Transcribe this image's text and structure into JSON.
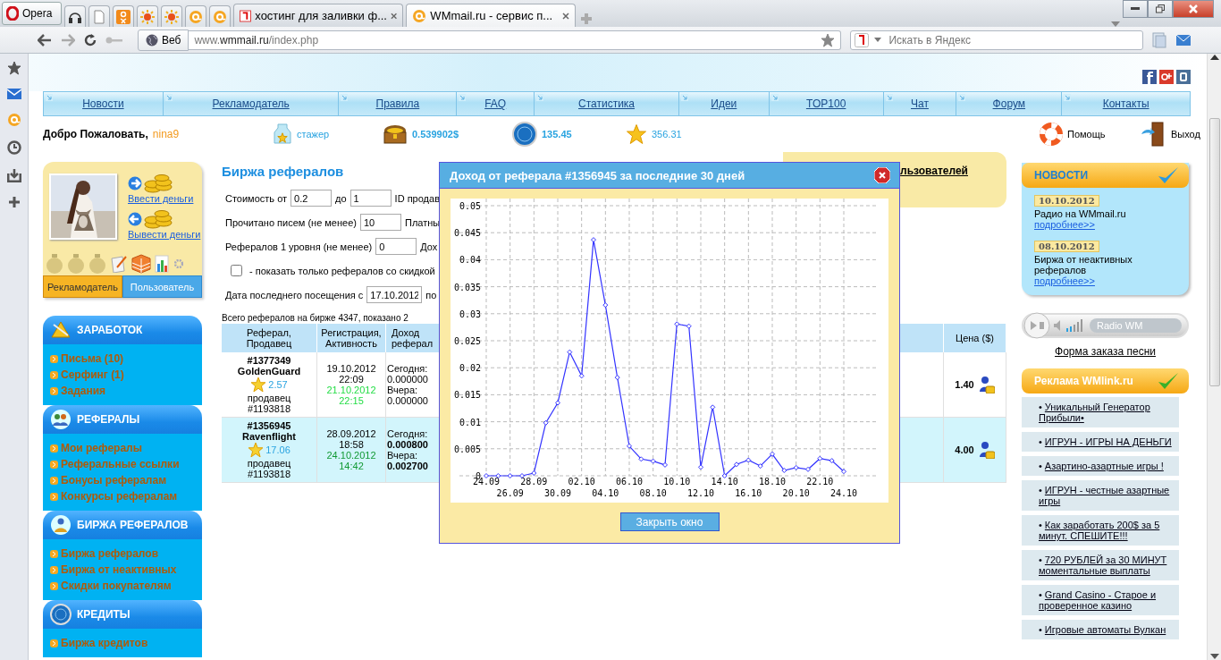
{
  "browser": {
    "menu_button": "Opera",
    "tabs": [
      {
        "title": "хостинг для заливки ф...",
        "selected": false
      },
      {
        "title": "WMmail.ru - сервис п...",
        "selected": true
      }
    ],
    "address": {
      "mode": "Веб",
      "url": "www.**wmmail.ru**/index.php"
    },
    "search": {
      "placeholder": "Искать в Яндекс"
    }
  },
  "nav": [
    "Новости",
    "Рекламодатель",
    "Правила",
    "FAQ",
    "Статистика",
    "Идеи",
    "TOP100",
    "Чат",
    "Форум",
    "Контакты"
  ],
  "welcome": {
    "greeting": "Добро Пожаловать,",
    "user": "nina9",
    "status": "стажер",
    "balance": "0.539902$",
    "credits": "135.45",
    "rating": "356.31",
    "help": "Помощь",
    "logout": "Выход"
  },
  "user_card": {
    "deposit": "Ввести деньги",
    "withdraw": "Вывести деньги",
    "tabs": [
      {
        "label": "Рекламодатель",
        "selected": true
      },
      {
        "label": "Пользователь",
        "selected": false
      }
    ]
  },
  "menu": [
    {
      "title": "ЗАРАБОТОК",
      "items": [
        "Письма (10)",
        "Серфинг (1)",
        "Задания"
      ]
    },
    {
      "title": "РЕФЕРАЛЫ",
      "items": [
        "Мои рефералы",
        "Реферальные ссылки",
        "Бонусы рефералам",
        "Конкурсы рефералам"
      ]
    },
    {
      "title": "БИРЖА РЕФЕРАЛОВ",
      "items": [
        "Биржа рефералов",
        "Биржа от неактивных",
        "Скидки покупателям"
      ]
    },
    {
      "title": "КРЕДИТЫ",
      "items": [
        "Биржа кредитов"
      ]
    }
  ],
  "main": {
    "title": "Биржа рефералов",
    "side_box": "льзователей",
    "filters": [
      [
        {
          "kind": "label",
          "text": "Стоимость от"
        },
        {
          "kind": "field",
          "value": "0.2"
        },
        {
          "kind": "label",
          "text": "до"
        },
        {
          "kind": "field",
          "value": "1"
        },
        {
          "kind": "label",
          "text": "ID продав"
        }
      ],
      [
        {
          "kind": "label",
          "text": "Прочитано писем (не менее)"
        },
        {
          "kind": "field",
          "value": "10"
        },
        {
          "kind": "label",
          "text": "Платны"
        }
      ],
      [
        {
          "kind": "label",
          "text": "Рефералов 1 уровня (не менее)"
        },
        {
          "kind": "field",
          "value": "0"
        },
        {
          "kind": "label",
          "text": "Дох"
        }
      ],
      [
        {
          "kind": "checkbox",
          "checked": false
        },
        {
          "kind": "label",
          "text": "- показать только рефералов со скидкой"
        }
      ],
      [
        {
          "kind": "label",
          "text": "Дата последнего посещения с"
        },
        {
          "kind": "field",
          "value": "17.10.2012"
        },
        {
          "kind": "label",
          "text": "по"
        }
      ]
    ],
    "summary": "Всего рефералов на бирже 4347, показано 2",
    "table": {
      "columns": [
        "Реферал,\nПродавец",
        "Регистрация,\nАктивность",
        "Доход\nреферал",
        "Цена ($)"
      ],
      "rows": [
        {
          "selected": false,
          "ref": "#1377349",
          "name": "GoldenGuard",
          "rating": "2.57",
          "seller_label": "продавец",
          "seller": "#1193818",
          "registered": [
            "19.10.2012",
            "22:09"
          ],
          "active": {
            "date": "21.10.2012",
            "time": "22:15",
            "color": "#22dd44"
          },
          "income": [
            "Сегодня:",
            "0.000000",
            "Вчера:",
            "0.000000"
          ],
          "income_bold": false,
          "price": "1.40"
        },
        {
          "selected": true,
          "ref": "#1356945",
          "name": "Ravenflight",
          "rating": "17.06",
          "seller_label": "продавец",
          "seller": "#1193818",
          "registered": [
            "28.09.2012",
            "18:58"
          ],
          "active": {
            "date": "24.10.2012",
            "time": "14:42",
            "color": "#119933"
          },
          "income": [
            "Сегодня:",
            "0.000800",
            "Вчера:",
            "0.002700"
          ],
          "income_bold": true,
          "price": "4.00"
        }
      ]
    }
  },
  "modal": {
    "title": "Доход от реферала #1356945 за последние 30 дней",
    "close_button": "Закрыть окно",
    "chart_data": {
      "type": "line",
      "categories": [
        "24.09",
        null,
        "26.09",
        null,
        "28.09",
        null,
        "30.09",
        null,
        "02.10",
        null,
        "04.10",
        null,
        "06.10",
        null,
        "08.10",
        null,
        "10.10",
        null,
        "12.10",
        null,
        "14.10",
        null,
        "16.10",
        null,
        "18.10",
        null,
        "20.10",
        null,
        "22.10",
        null,
        "24.10"
      ],
      "grid": true,
      "series": [
        {
          "color": "#3333ff",
          "marker": "diamond",
          "values": [
            0,
            0,
            0,
            0,
            0.0005,
            0.0098,
            0.0135,
            0.0229,
            0.0185,
            0.0437,
            0.0316,
            0.0182,
            0.0055,
            0.0031,
            0.0027,
            0.002,
            0.0281,
            0.0277,
            0.0016,
            0.0127,
            0,
            0.0021,
            0.0029,
            0.0018,
            0.004,
            0.001,
            0.0015,
            0.0012,
            0.0032,
            0.0028,
            0.0008
          ]
        }
      ],
      "ylim": [
        0,
        0.05
      ],
      "yticks": [
        0,
        0.005,
        0.01,
        0.015,
        0.02,
        0.025,
        0.03,
        0.035,
        0.04,
        0.045,
        0.05
      ]
    }
  },
  "news": {
    "title": "НОВОСТИ",
    "items": [
      {
        "date": "10.10.2012",
        "text": "Радио на WMmail.ru",
        "link": "подробнее>>"
      },
      {
        "date": "08.10.2012",
        "text": "Биржа от неактивных рефералов",
        "link": "подробнее>>"
      }
    ]
  },
  "radio": {
    "station": "Radio WM",
    "order_link": "Форма заказа песни"
  },
  "ads": {
    "title": "Реклама WMlink.ru",
    "items": [
      {
        "bullet": "•",
        "text": "Уникальный Генератор Прибыли•"
      },
      {
        "bullet": "•",
        "text": "ИГРУН - ИГРЫ НА ДЕНЬГИ"
      },
      {
        "bullet": "•",
        "text": "Азартино-азартные игры !"
      },
      {
        "bullet": "•",
        "text": "ИГРУН - честные азартные игры"
      },
      {
        "bullet": "•",
        "text": "Как заработать 200$ за 5 минут. СПЕШИТЕ!!!"
      },
      {
        "bullet": "•",
        "text": "720 РУБЛЕЙ за 30 МИНУТ моментальные выплаты"
      },
      {
        "bullet": "•",
        "text": "Grand Casino - Старое и проверенное казино"
      },
      {
        "bullet": "•",
        "text": "Игровые автоматы Вулкан"
      }
    ]
  }
}
